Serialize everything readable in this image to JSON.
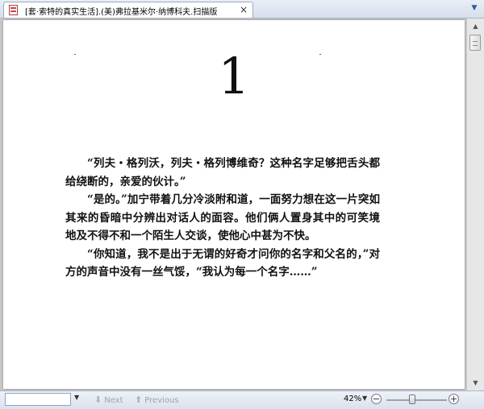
{
  "tab": {
    "title": "[套·索特的真实生活].(美)弗拉基米尔·纳博科夫.扫描版",
    "close_glyph": "×",
    "dropdown_glyph": "▼",
    "icon": "pdf-file-icon"
  },
  "document": {
    "chapter_number": "1",
    "paragraphs": [
      "“列夫・格列沃，列夫・格列博维奇？这种名字足够把舌头都给绕断的，亲爱的伙计。”",
      "“是的。”加宁带着几分冷淡附和道，一面努力想在这一片突如其来的昏暗中分辨出对话人的面容。他们俩人置身其中的可笑境地及不得不和一个陌生人交谈，使他心中甚为不快。",
      "“你知道，我不是出于无谓的好奇才问你的名字和父名的，”对方的声音中没有一丝气馁，“我认为每一个名字……”"
    ]
  },
  "scrollbar": {
    "up_glyph": "▲",
    "down_glyph": "▼"
  },
  "toolbar": {
    "find_value": "",
    "find_dropdown_glyph": "▼",
    "next_label": "Next",
    "previous_label": "Previous",
    "next_icon": "arrow-down-icon",
    "previous_icon": "arrow-up-icon",
    "zoom_level": "42%",
    "zoom_dropdown_glyph": "▼",
    "zoom_out_glyph": "−",
    "zoom_in_glyph": "+",
    "zoom_slider_value": 0.42
  }
}
